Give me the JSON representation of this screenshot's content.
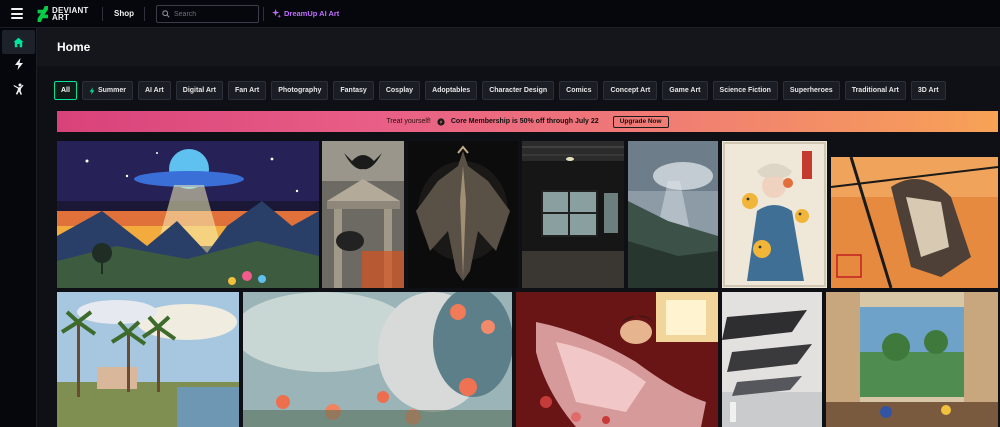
{
  "topbar": {
    "logo_line1": "DEVIANT",
    "logo_line2": "ART",
    "shop_label": "Shop",
    "search_placeholder": "Search",
    "dreamup_label": "DreamUp AI Art",
    "menu_icon": "hamburger-icon"
  },
  "sidebar": {
    "items": [
      {
        "icon": "home-icon",
        "active": true
      },
      {
        "icon": "lightning-icon",
        "active": false
      },
      {
        "icon": "dancer-icon",
        "active": false
      }
    ]
  },
  "page": {
    "title": "Home"
  },
  "chips": [
    {
      "label": "All",
      "active": true
    },
    {
      "label": "Summer",
      "icon": "lightning-icon"
    },
    {
      "label": "AI Art"
    },
    {
      "label": "Digital Art"
    },
    {
      "label": "Fan Art"
    },
    {
      "label": "Photography"
    },
    {
      "label": "Fantasy"
    },
    {
      "label": "Cosplay"
    },
    {
      "label": "Adoptables"
    },
    {
      "label": "Character Design"
    },
    {
      "label": "Comics"
    },
    {
      "label": "Concept Art"
    },
    {
      "label": "Game Art"
    },
    {
      "label": "Science Fiction"
    },
    {
      "label": "Superheroes"
    },
    {
      "label": "Traditional Art"
    },
    {
      "label": "3D Art"
    }
  ],
  "banner": {
    "lead": "Treat yourself!",
    "offer": "Core Membership is 50% off through July 22",
    "cta": "Upgrade Now"
  },
  "colors": {
    "accent_green": "#00e59b",
    "dreamup_purple": "#c06dff",
    "background": "#06070d",
    "banner_start": "#d8427a",
    "banner_end": "#f7a256"
  },
  "gallery": [
    {
      "name": "ufo-landscape-artwork"
    },
    {
      "name": "vulture-temple-artwork"
    },
    {
      "name": "dark-bat-creature-artwork"
    },
    {
      "name": "industrial-hall-photo"
    },
    {
      "name": "misty-valley-photo"
    },
    {
      "name": "kimono-girl-fish-artwork"
    },
    {
      "name": "orange-creature-sketch-artwork"
    },
    {
      "name": "palm-trees-painting"
    },
    {
      "name": "flower-face-artwork"
    },
    {
      "name": "reclining-kimono-woman-artwork"
    },
    {
      "name": "surreal-shapes-artwork"
    },
    {
      "name": "garden-window-painting"
    }
  ]
}
